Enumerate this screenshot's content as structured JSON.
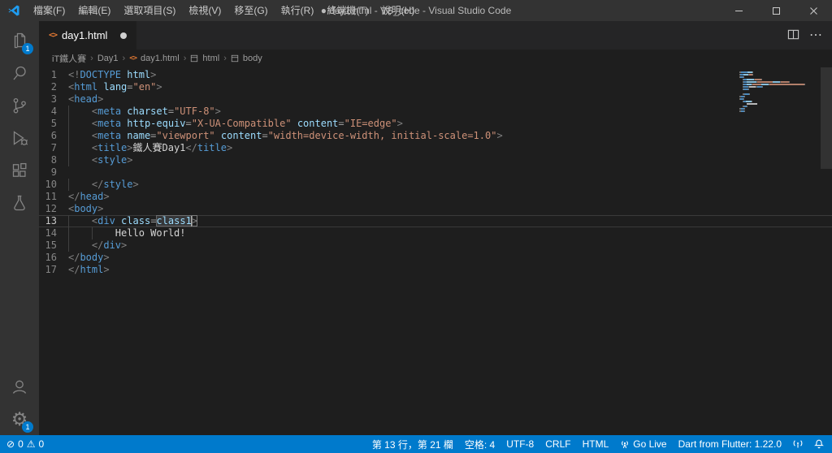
{
  "colors": {
    "accent": "#007acc",
    "statusbar_bg": "#007acc",
    "editor_bg": "#1e1e1e",
    "titlebar_bg": "#333333",
    "tag_color": "#569cd6",
    "attribute_color": "#9cdcfe",
    "string_color": "#ce9178",
    "text_color": "#d4d4d4",
    "punctuation_color": "#808080",
    "file_icon_color": "#e37933"
  },
  "titlebar": {
    "title": "● day1.html - VS_code - Visual Studio Code",
    "menus": [
      "檔案(F)",
      "編輯(E)",
      "選取項目(S)",
      "檢視(V)",
      "移至(G)",
      "執行(R)",
      "終端機(T)",
      "說明(H)"
    ]
  },
  "activitybar": {
    "explorer_badge": "1",
    "settings_badge": "1"
  },
  "tab": {
    "label": "day1.html"
  },
  "breadcrumbs": {
    "items": [
      "iT鐵人賽",
      "Day1",
      "day1.html",
      "html",
      "body"
    ]
  },
  "editor": {
    "current_line": 13,
    "cursor_column": 21,
    "lines": [
      [
        [
          "p",
          "<!"
        ],
        [
          "k",
          "DOCTYPE"
        ],
        [
          "a",
          " html"
        ],
        [
          "p",
          ">"
        ]
      ],
      [
        [
          "p",
          "<"
        ],
        [
          "t",
          "html"
        ],
        [
          "a",
          " lang"
        ],
        [
          "o",
          "="
        ],
        [
          "s",
          "\"en\""
        ],
        [
          "p",
          ">"
        ]
      ],
      [
        [
          "p",
          "<"
        ],
        [
          "t",
          "head"
        ],
        [
          "p",
          ">"
        ]
      ],
      [
        [
          "w",
          "    "
        ],
        [
          "p",
          "<"
        ],
        [
          "t",
          "meta"
        ],
        [
          "a",
          " charset"
        ],
        [
          "o",
          "="
        ],
        [
          "s",
          "\"UTF-8\""
        ],
        [
          "p",
          ">"
        ]
      ],
      [
        [
          "w",
          "    "
        ],
        [
          "p",
          "<"
        ],
        [
          "t",
          "meta"
        ],
        [
          "a",
          " http-equiv"
        ],
        [
          "o",
          "="
        ],
        [
          "s",
          "\"X-UA-Compatible\""
        ],
        [
          "a",
          " content"
        ],
        [
          "o",
          "="
        ],
        [
          "s",
          "\"IE=edge\""
        ],
        [
          "p",
          ">"
        ]
      ],
      [
        [
          "w",
          "    "
        ],
        [
          "p",
          "<"
        ],
        [
          "t",
          "meta"
        ],
        [
          "a",
          " name"
        ],
        [
          "o",
          "="
        ],
        [
          "s",
          "\"viewport\""
        ],
        [
          "a",
          " content"
        ],
        [
          "o",
          "="
        ],
        [
          "s",
          "\"width=device-width, initial-scale=1.0\""
        ],
        [
          "p",
          ">"
        ]
      ],
      [
        [
          "w",
          "    "
        ],
        [
          "p",
          "<"
        ],
        [
          "t",
          "title"
        ],
        [
          "p",
          ">"
        ],
        [
          "x",
          "鐵人賽Day1"
        ],
        [
          "p",
          "</"
        ],
        [
          "t",
          "title"
        ],
        [
          "p",
          ">"
        ]
      ],
      [
        [
          "w",
          "    "
        ],
        [
          "p",
          "<"
        ],
        [
          "t",
          "style"
        ],
        [
          "p",
          ">"
        ]
      ],
      [],
      [
        [
          "w",
          "    "
        ],
        [
          "p",
          "</"
        ],
        [
          "t",
          "style"
        ],
        [
          "p",
          ">"
        ]
      ],
      [
        [
          "p",
          "</"
        ],
        [
          "t",
          "head"
        ],
        [
          "p",
          ">"
        ]
      ],
      [
        [
          "p",
          "<"
        ],
        [
          "t",
          "body"
        ],
        [
          "p",
          ">"
        ]
      ],
      [
        [
          "w",
          "    "
        ],
        [
          "p",
          "<"
        ],
        [
          "t",
          "div"
        ],
        [
          "a",
          " class"
        ],
        [
          "o",
          "="
        ],
        [
          "a hl",
          "class1"
        ],
        [
          "caret",
          ""
        ],
        [
          "p bm",
          ">"
        ]
      ],
      [
        [
          "w",
          "        "
        ],
        [
          "x",
          "Hello World!"
        ]
      ],
      [
        [
          "w",
          "    "
        ],
        [
          "p",
          "</"
        ],
        [
          "t",
          "div"
        ],
        [
          "p",
          ">"
        ]
      ],
      [
        [
          "p",
          "</"
        ],
        [
          "t",
          "body"
        ],
        [
          "p",
          ">"
        ]
      ],
      [
        [
          "p",
          "</"
        ],
        [
          "t",
          "html"
        ],
        [
          "p",
          ">"
        ]
      ]
    ]
  },
  "statusbar": {
    "errors": "0",
    "warnings": "0",
    "cursor_position": "第 13 行，第 21 欄",
    "indentation": "空格: 4",
    "encoding": "UTF-8",
    "eol": "CRLF",
    "language": "HTML",
    "go_live": "Go Live",
    "dart": "Dart from Flutter: 1.22.0"
  }
}
